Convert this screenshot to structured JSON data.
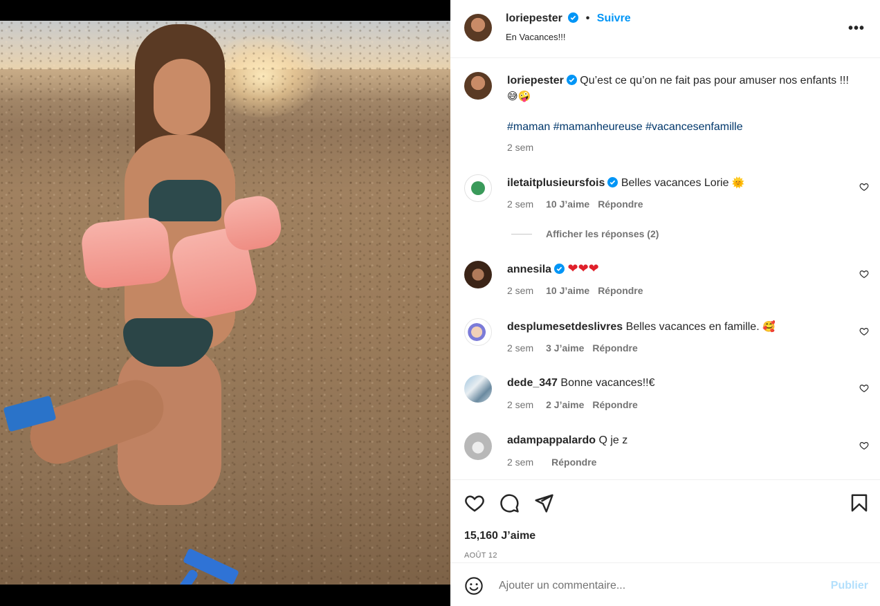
{
  "post": {
    "author": "loriepester",
    "follow_label": "Suivre",
    "location": "En Vacances!!!",
    "more_icon": "more-horizontal-icon",
    "caption": {
      "text": "Qu’est ce qu’on ne fait pas pour amuser nos enfants !!!",
      "emojis": "😅🤪",
      "hashtags": "#maman #mamanheureuse #vacancesenfamille",
      "time": "2 sem"
    },
    "likes": "15,160 J’aime",
    "date": "AOÛT 12"
  },
  "comments": [
    {
      "user": "iletaitplusieursfois",
      "verified": true,
      "text": "Belles vacances Lorie",
      "emoji": "🌞",
      "time": "2 sem",
      "likes": "10 J’aime",
      "reply": "Répondre"
    },
    {
      "user": "annesila",
      "verified": true,
      "text": "",
      "emoji": "❤❤❤",
      "time": "2 sem",
      "likes": "10 J’aime",
      "reply": "Répondre"
    },
    {
      "user": "desplumesetdeslivres",
      "verified": false,
      "text": "Belles vacances en famille.",
      "emoji": "🥰",
      "time": "2 sem",
      "likes": "3 J’aime",
      "reply": "Répondre"
    },
    {
      "user": "dede_347",
      "verified": false,
      "text": "Bonne vacances!!€",
      "emoji": "",
      "time": "2 sem",
      "likes": "2 J’aime",
      "reply": "Répondre"
    },
    {
      "user": "adampappalardo",
      "verified": false,
      "text": "Q je z",
      "emoji": "",
      "time": "2 sem",
      "likes": "",
      "reply": "Répondre"
    }
  ],
  "show_replies": "Afficher les réponses (2)",
  "add_comment": {
    "placeholder": "Ajouter un commentaire...",
    "publish": "Publier"
  },
  "colors": {
    "accent": "#0095f6",
    "hashtag": "#00376b",
    "muted": "#737373",
    "publish_disabled": "#b2dffc"
  }
}
